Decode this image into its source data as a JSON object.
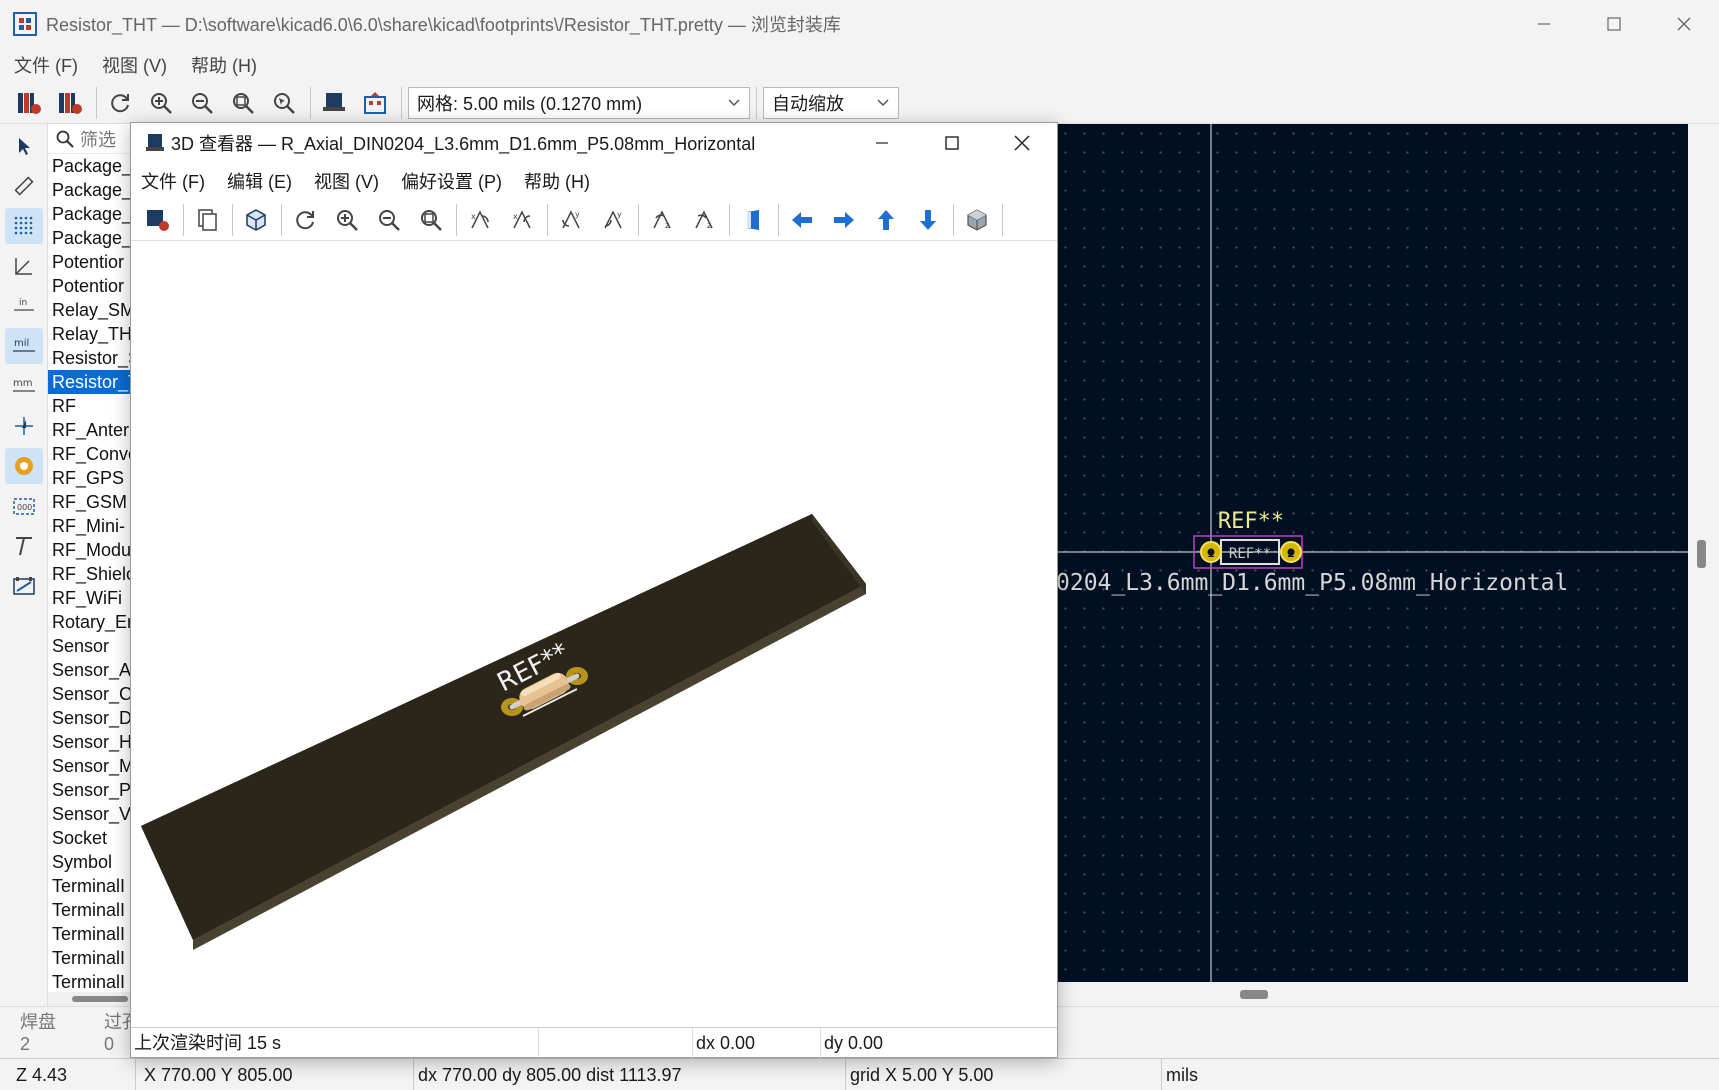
{
  "main_window": {
    "title": "Resistor_THT — D:\\software\\kicad6.0\\6.0\\share\\kicad\\footprints\\/Resistor_THT.pretty — 浏览封装库",
    "menu": [
      "文件 (F)",
      "视图 (V)",
      "帮助 (H)"
    ],
    "toolbar": {
      "grid_combo": "网格: 5.00 mils (0.1270 mm)",
      "zoom_combo": "自动缩放"
    }
  },
  "library_panel": {
    "filter_placeholder": "筛选",
    "items": [
      "Package_",
      "Package_",
      "Package_",
      "Package_",
      "Potentior",
      "Potentior",
      "Relay_SM",
      "Relay_TH",
      "Resistor_S",
      "Resistor_T",
      "RF",
      "RF_Anter",
      "RF_Conve",
      "RF_GPS",
      "RF_GSM",
      "RF_Mini-",
      "RF_Modu",
      "RF_Shielc",
      "RF_WiFi",
      "Rotary_Er",
      "Sensor",
      "Sensor_A",
      "Sensor_C",
      "Sensor_D",
      "Sensor_H",
      "Sensor_M",
      "Sensor_Pr",
      "Sensor_V",
      "Socket",
      "Symbol",
      "TerminalI",
      "TerminalI",
      "TerminalI",
      "TerminalI",
      "TerminalI"
    ],
    "selected_index": 9
  },
  "canvas": {
    "ref_label": "REF**",
    "pad_ref_label": "REF**",
    "footprint_label": "0204_L3.6mm_D1.6mm_P5.08mm_Horizontal",
    "pad_1": "1",
    "pad_2": "2"
  },
  "message_panel": {
    "col1_header": "焊盘",
    "col1_value": "2",
    "col2_header": "过孔",
    "col2_value": "0"
  },
  "statusbar": {
    "zoom": "Z 4.43",
    "xy": "X 770.00  Y 805.00",
    "delta": "dx 770.00  dy 805.00  dist 1113.97",
    "grid": "grid X 5.00  Y 5.00",
    "units": "mils"
  },
  "viewer": {
    "title": "3D 查看器 — R_Axial_DIN0204_L3.6mm_D1.6mm_P5.08mm_Horizontal",
    "menu": [
      "文件 (F)",
      "编辑 (E)",
      "视图 (V)",
      "偏好设置 (P)",
      "帮助 (H)"
    ],
    "render_ref": "REF**",
    "status": {
      "render_time": "上次渲染时间 15 s",
      "dx": "dx 0.00",
      "dy": "dy 0.00"
    }
  },
  "colors": {
    "canvas_bg": "#001022",
    "selection": "#0a6bd6",
    "board_top": "#2a2419",
    "pad_gold": "#c8a81e",
    "silk_yellow": "#f0e68c",
    "arrow_blue": "#1f6fd0"
  }
}
